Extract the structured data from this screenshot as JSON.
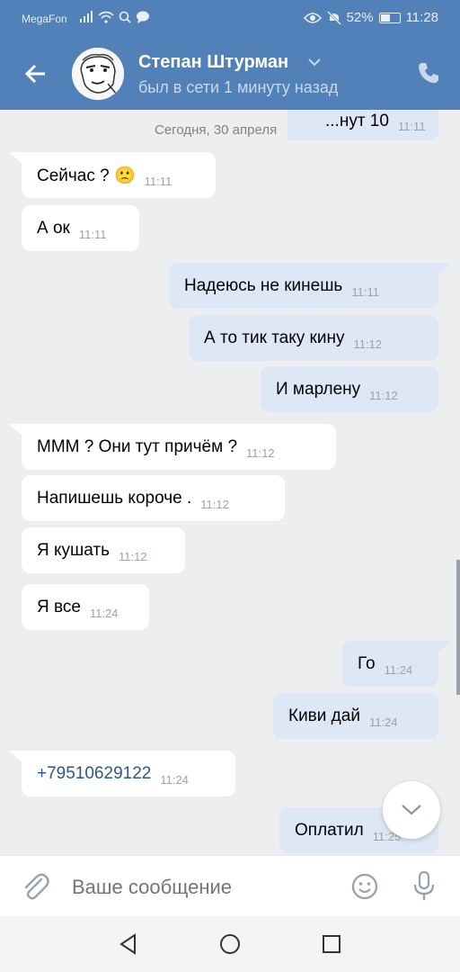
{
  "status_bar": {
    "carrier": "MegaFon",
    "battery": "52%",
    "battery_level": 0.52,
    "time": "11:28"
  },
  "header": {
    "contact_name": "Степан Штурман",
    "contact_status": "был в сети 1 минуту назад"
  },
  "chat": {
    "date_separator": "Сегодня, 30 апреля",
    "partial_top_message": {
      "text": "...нут 10",
      "time": "11:11"
    },
    "messages": [
      {
        "dir": "in",
        "text": "Сейчас ? 🙁",
        "time": "11:11"
      },
      {
        "dir": "in",
        "text": "А ок",
        "time": "11:11"
      },
      {
        "dir": "out",
        "text": "Надеюсь не кинешь",
        "time": "11:11"
      },
      {
        "dir": "out",
        "text": "А то тик таку кину",
        "time": "11:12"
      },
      {
        "dir": "out",
        "text": "И марлену",
        "time": "11:12"
      },
      {
        "dir": "in",
        "text": "МММ ? Они тут причём ?",
        "time": "11:12"
      },
      {
        "dir": "in",
        "text": "Напишешь короче .",
        "time": "11:12"
      },
      {
        "dir": "in",
        "text": "Я кушать",
        "time": "11:12"
      },
      {
        "dir": "in",
        "text": "Я все",
        "time": "11:24"
      },
      {
        "dir": "out",
        "text": "Го",
        "time": "11:24"
      },
      {
        "dir": "out",
        "text": "Киви дай",
        "time": "11:24"
      },
      {
        "dir": "in",
        "text": "+79510629122",
        "time": "11:24",
        "link": true
      },
      {
        "dir": "out",
        "text": "Оплатил",
        "time": "11:25"
      }
    ]
  },
  "composer": {
    "placeholder": "Ваше сообщение"
  },
  "icons": {
    "back": "arrow-left-icon",
    "call": "phone-icon",
    "attach": "paperclip-icon",
    "emoji": "smiley-icon",
    "mic": "microphone-icon",
    "scroll_down": "chevron-down-icon",
    "nav_back": "triangle-back-icon",
    "nav_home": "circle-home-icon",
    "nav_recent": "square-recent-icon"
  },
  "colors": {
    "header": "#5181b8",
    "incoming_bubble": "#ffffff",
    "outgoing_bubble": "#dde7f6",
    "chat_background": "#edeef0",
    "link": "#2a5885"
  }
}
